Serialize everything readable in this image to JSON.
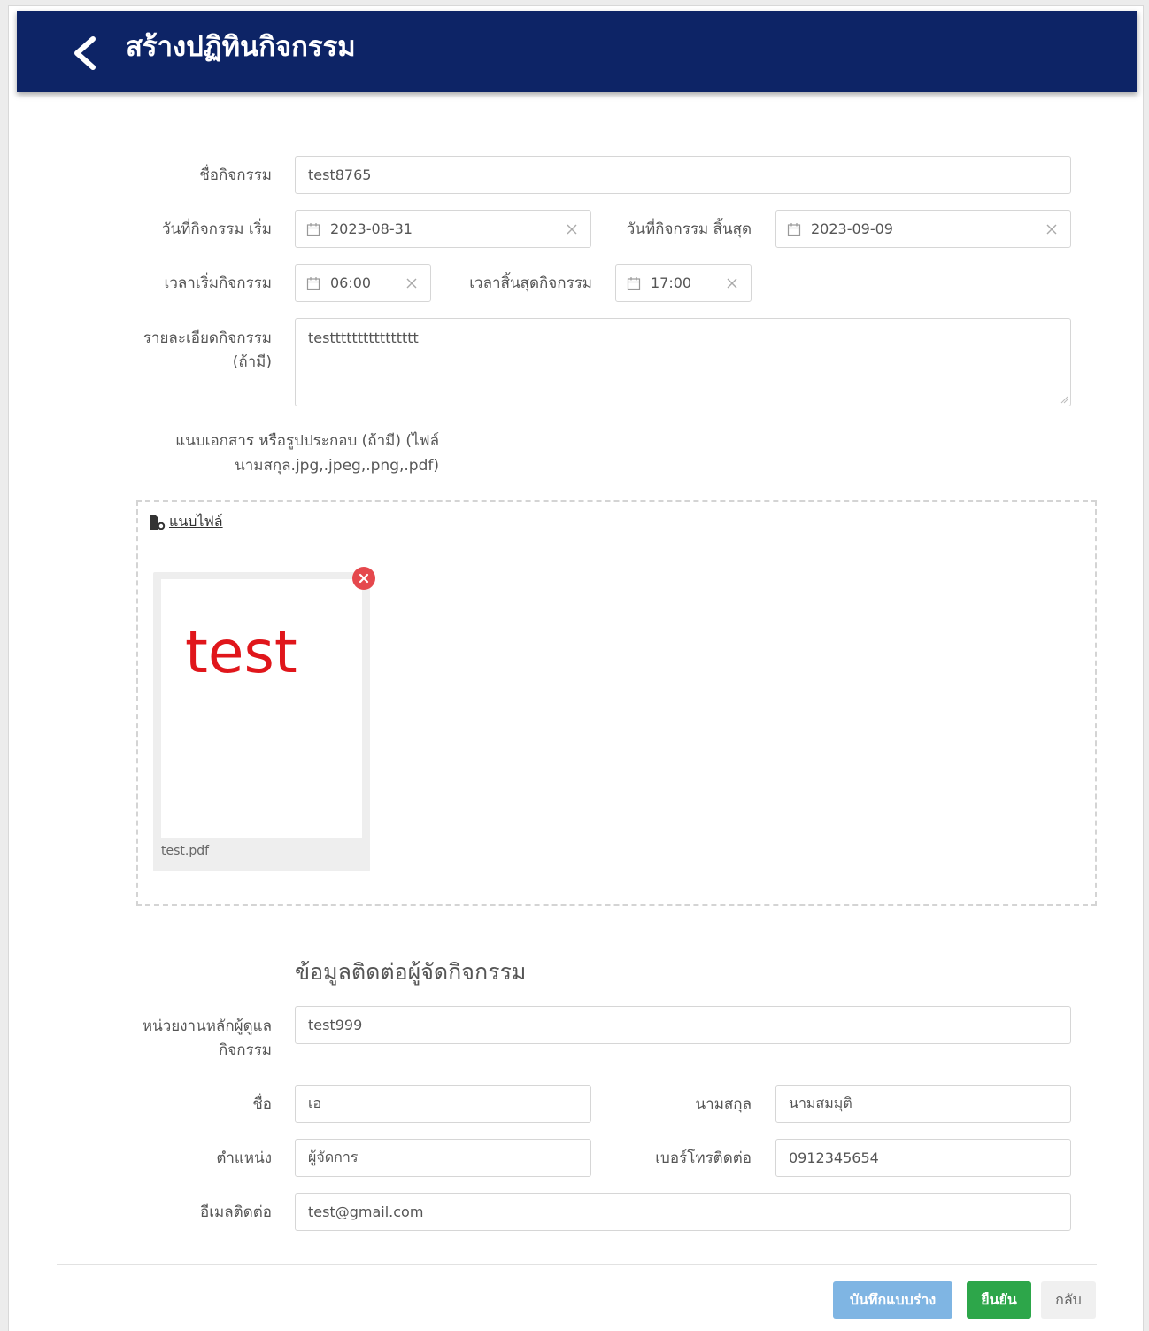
{
  "header": {
    "title": "สร้างปฏิทินกิจกรรม"
  },
  "form": {
    "activity_name": {
      "label": "ชื่อกิจกรรม",
      "value": "test8765"
    },
    "start_date": {
      "label": "วันที่กิจกรรม เริ่ม",
      "value": "2023-08-31"
    },
    "end_date": {
      "label": "วันที่กิจกรรม สิ้นสุด",
      "value": "2023-09-09"
    },
    "start_time": {
      "label": "เวลาเริ่มกิจกรรม",
      "value": "06:00"
    },
    "end_time": {
      "label": "เวลาสิ้นสุดกิจกรรม",
      "value": "17:00"
    },
    "details": {
      "label_line1": "รายละเอียดกิจกรรม",
      "label_line2": "(ถ้ามี)",
      "value": "testttttttttttttttt"
    },
    "attachment": {
      "label_line1": "แนบเอกสาร หรือรูปประกอบ (ถ้ามี) (ไฟล์",
      "label_line2": "นามสกุล.jpg,.jpeg,.png,.pdf)",
      "link_label": "แนบไฟล์",
      "file": {
        "preview_text": "test",
        "filename": "test.pdf"
      }
    }
  },
  "contact": {
    "section_title": "ข้อมูลติดต่อผู้จัดกิจกรรม",
    "agency": {
      "label_line1": "หน่วยงานหลักผู้ดูแล",
      "label_line2": "กิจกรรม",
      "value": "test999"
    },
    "first_name": {
      "label": "ชื่อ",
      "value": "เอ"
    },
    "last_name": {
      "label": "นามสกุล",
      "value": "นามสมมุติ"
    },
    "position": {
      "label": "ตำแหน่ง",
      "value": "ผู้จัดการ"
    },
    "phone": {
      "label": "เบอร์โทรติดต่อ",
      "value": "0912345654"
    },
    "email": {
      "label": "อีเมลติดต่อ",
      "value": "test@gmail.com"
    }
  },
  "actions": {
    "save_draft": "บันทึกแบบร่าง",
    "confirm": "ยืนยัน",
    "back": "กลับ"
  },
  "colors": {
    "header_bg": "#0d2466",
    "draft_btn": "#7fb5e3",
    "confirm_btn": "#2da64a",
    "remove_icon": "#e5484d",
    "preview_text": "#e0161b"
  }
}
